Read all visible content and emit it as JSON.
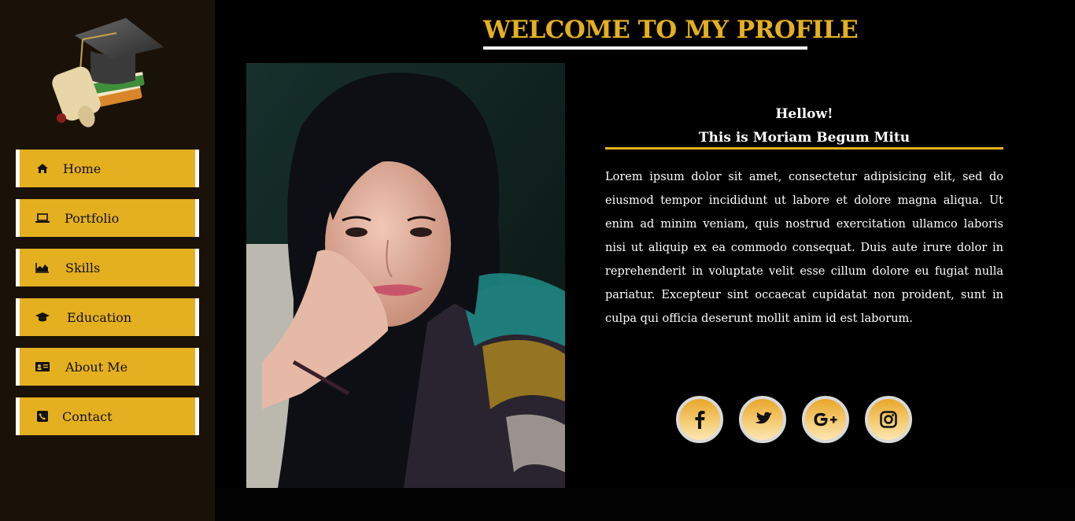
{
  "header": {
    "title": "WELCOME TO MY PROFILE"
  },
  "sidebar": {
    "logo_icon": "graduation-books-icon",
    "items": [
      {
        "label": "Home",
        "icon": "home-icon"
      },
      {
        "label": "Portfolio",
        "icon": "laptop-icon"
      },
      {
        "label": "Skills",
        "icon": "area-chart-icon"
      },
      {
        "label": "Education",
        "icon": "graduation-cap-icon"
      },
      {
        "label": "About Me",
        "icon": "id-card-icon"
      },
      {
        "label": "Contact",
        "icon": "phone-icon"
      }
    ]
  },
  "profile": {
    "greeting": "Hellow!",
    "name_line": "This is Moriam Begum Mitu",
    "bio": "Lorem ipsum dolor sit amet, consectetur adipisicing elit, sed do eiusmod tempor incididunt ut labore et dolore magna aliqua. Ut enim ad minim veniam, quis nostrud exercitation ullamco laboris nisi ut aliquip ex ea commodo consequat. Duis aute irure dolor in reprehenderit in voluptate velit esse cillum dolore eu fugiat nulla pariatur. Excepteur sint occaecat cupidatat non proident, sunt in culpa qui officia deserunt mollit anim id est laborum."
  },
  "social": [
    {
      "icon": "facebook-icon"
    },
    {
      "icon": "twitter-icon"
    },
    {
      "icon": "google-plus-icon"
    },
    {
      "icon": "instagram-icon"
    }
  ],
  "colors": {
    "accent": "#e4b020",
    "sidebar_bg": "#1a1208",
    "main_bg": "#000000"
  }
}
